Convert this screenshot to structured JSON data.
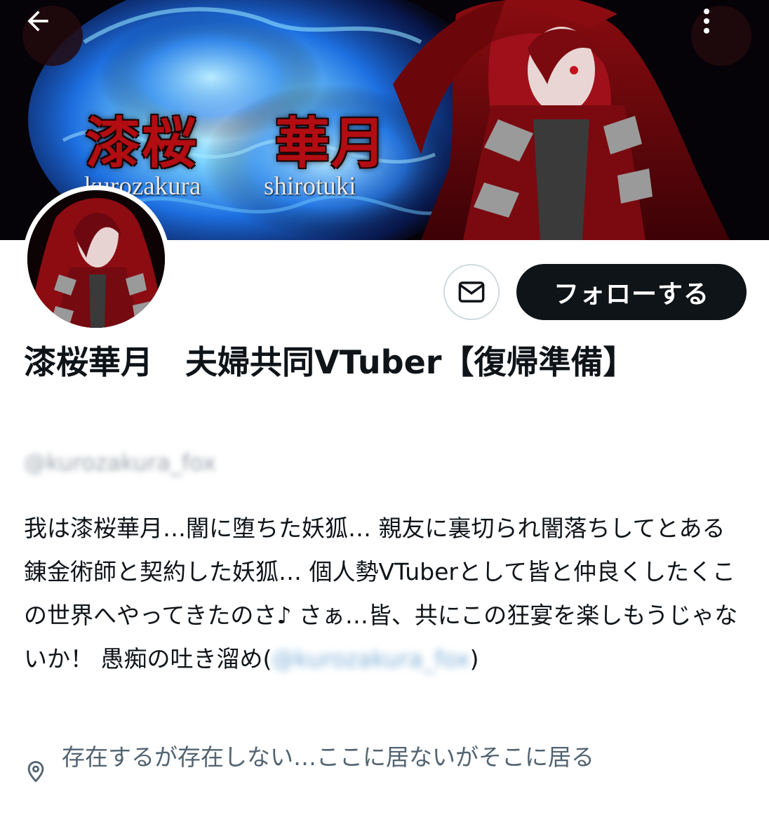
{
  "header": {
    "back_icon": "arrow-left-icon",
    "more_icon": "more-vertical-icon",
    "banner_name_jp_left": "漆桜",
    "banner_name_jp_right": "華月",
    "banner_name_en_left": "kurozakura",
    "banner_name_en_right": "shirotuki"
  },
  "actions": {
    "message_icon": "envelope-icon",
    "follow_label": "フォローする"
  },
  "profile": {
    "display_name": "漆桜華月　夫婦共同VTuber【復帰準備】",
    "handle": "@kurozakura_fox",
    "bio_main": "我は漆桜華月…闇に堕ちた妖狐… 親友に裏切られ闇落ちしてとある錬金術師と契約した妖狐… 個人勢VTuberとして皆と仲良くしたくこの世界へやってきたのさ♪ さぁ…皆、共にこの狂宴を楽しもうじゃないか！ 愚痴の吐き溜め",
    "bio_paren_open": "(",
    "bio_mention": "@kurozakura_fox",
    "bio_paren_close": ")",
    "location_icon": "location-pin-icon",
    "location": "存在するが存在しない…ここに居ないがそこに居る"
  },
  "colors": {
    "follow_bg": "#0f1419",
    "secondary_text": "#536471",
    "banner_red": "#b20d12",
    "flame_blue": "#3aa0ff"
  }
}
